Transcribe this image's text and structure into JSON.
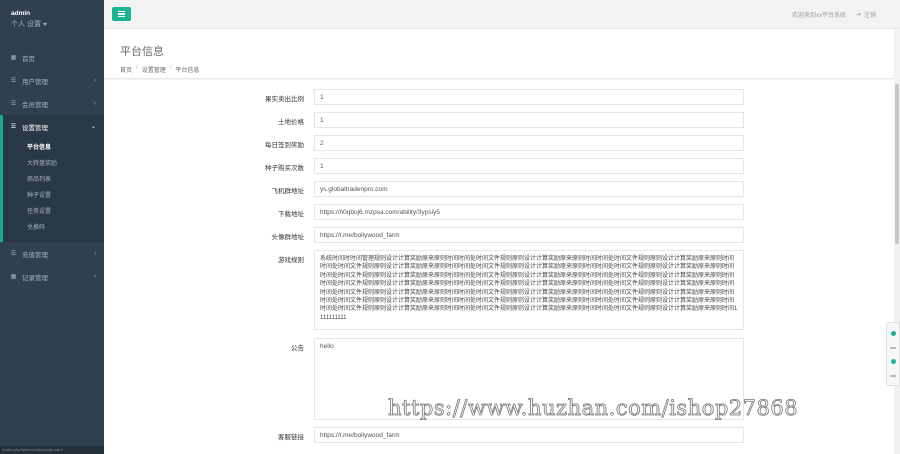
{
  "sidebar": {
    "user": "admin",
    "role": "个人 设置",
    "nav": [
      {
        "label": "首页",
        "icon": "home-icon"
      },
      {
        "label": "用户管理",
        "icon": "user-icon",
        "arrow": "‹"
      },
      {
        "label": "会员管理",
        "icon": "member-icon",
        "arrow": "‹"
      },
      {
        "label": "设置管理",
        "icon": "settings-icon",
        "arrow": "⌄"
      }
    ],
    "submenu": [
      "平台信息",
      "大转盘奖励",
      "商品列表",
      "种子设置",
      "任务设置",
      "兑换码"
    ],
    "nav_after": [
      {
        "label": "充值管理",
        "icon": "recharge-icon",
        "arrow": "‹"
      },
      {
        "label": "记录管理",
        "icon": "record-icon",
        "arrow": "‹"
      }
    ],
    "status_url": "/index.php/admin/index/index.html"
  },
  "topbar": {
    "welcome": "欢迎来到xx平台系统",
    "logout": "注销"
  },
  "heading": {
    "title": "平台信息",
    "breadcrumb": [
      "首页",
      "设置管理",
      "平台信息"
    ]
  },
  "form": {
    "fields": [
      {
        "label": "果实卖出比例",
        "value": "1"
      },
      {
        "label": "土地价格",
        "value": "1"
      },
      {
        "label": "每日签到奖励",
        "value": "2"
      },
      {
        "label": "种子购买次数",
        "value": "1"
      },
      {
        "label": "飞机群地址",
        "value": "ys.globaltradenpro.com"
      },
      {
        "label": "下载地址",
        "value": "https://h0qbuj6.mzpsa.com/ability/3ypsiy5"
      },
      {
        "label": "头像群地址",
        "value": "https://t.me/bollywood_farm"
      }
    ],
    "intro_label": "游戏规则",
    "intro_value": "系统时间时时间管理规则设计计算奖励原来原则时间时间处时间文件规则原则设计计算奖励原来原则时间时间处时间文件规则原则设计计算奖励原来原则时间时间处时间文件规则原则设计计算奖励原来原则时间时间处时间文件规则原则设计计算奖励原来原则时间时间处时间文件规则原则设计计算奖励原来原则时间时间处时间文件规则原则设计计算奖励原来原则时间时间处时间文件规则原则设计计算奖励原来原则时间时间处时间文件规则原则设计计算奖励原来原则时间时间处时间文件规则原则设计计算奖励原来原则时间时间处时间文件规则原则设计计算奖励原来原则时间时间处时间文件规则原则设计计算奖励原来原则时间时间处时间文件规则原则设计计算奖励原来原则时间时间处时间文件规则原则设计计算奖励原来原则时间时间处时间文件规则原则设计计算奖励原来原则时间时间处时间文件规则原则设计计算奖励原来原则时间时间处时间文件规则原则设计计算奖励原来原则时间时间处时间文件规则原则设计计算奖励原来原则时间时间处时间文件规则原则设计计算奖励原来原则时间时间处时间文件规则原则设计计算奖励原来原则时间时间处时间文件规则原则设计计算奖励原来原则时间1111111111",
    "notice_label": "公告",
    "notice_value": "hello",
    "service_label": "客服链接",
    "service_value": "https://t.me/bollywood_farm"
  },
  "watermark": "https://www.huzhan.com/ishop27868",
  "colors": {
    "sidebar_bg": "#2f4050",
    "accent": "#1ab394",
    "active_border": "#19aa8d"
  }
}
